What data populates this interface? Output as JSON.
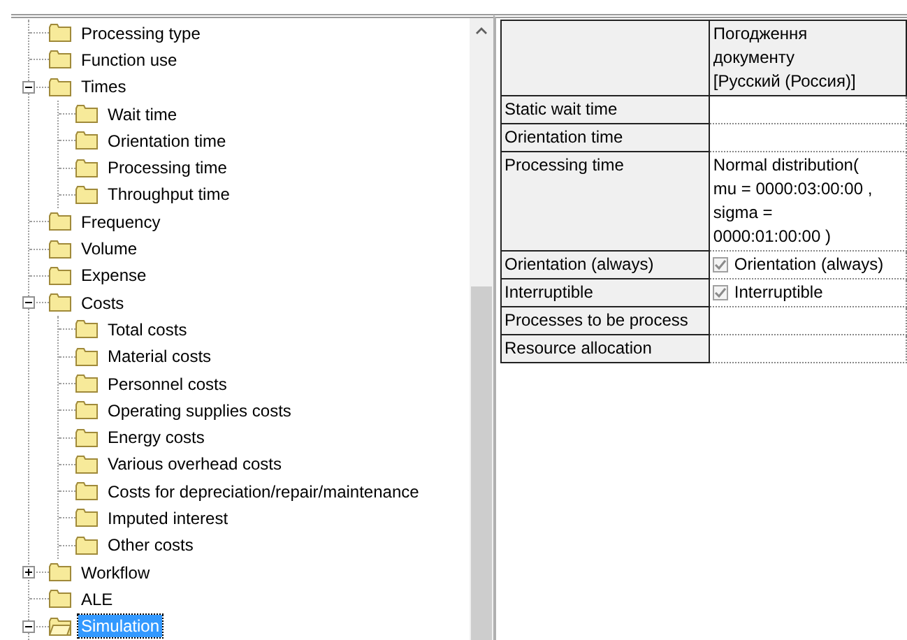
{
  "tree": {
    "items": [
      {
        "label": "Processing type",
        "selected": false
      },
      {
        "label": "Function use",
        "selected": false
      },
      {
        "label": "Times",
        "selected": false,
        "expanded": true,
        "children": [
          {
            "label": "Wait time",
            "selected": false
          },
          {
            "label": "Orientation time",
            "selected": false
          },
          {
            "label": "Processing time",
            "selected": false
          },
          {
            "label": "Throughput time",
            "selected": false
          }
        ]
      },
      {
        "label": "Frequency",
        "selected": false
      },
      {
        "label": "Volume",
        "selected": false
      },
      {
        "label": "Expense",
        "selected": false
      },
      {
        "label": "Costs",
        "selected": false,
        "expanded": true,
        "children": [
          {
            "label": "Total costs",
            "selected": false
          },
          {
            "label": "Material costs",
            "selected": false
          },
          {
            "label": "Personnel costs",
            "selected": false
          },
          {
            "label": "Operating supplies costs",
            "selected": false
          },
          {
            "label": "Energy costs",
            "selected": false
          },
          {
            "label": "Various overhead costs",
            "selected": false
          },
          {
            "label": "Costs for depreciation/repair/maintenance",
            "selected": false
          },
          {
            "label": "Imputed interest",
            "selected": false
          },
          {
            "label": "Other costs",
            "selected": false
          }
        ]
      },
      {
        "label": "Workflow",
        "selected": false,
        "expanded": false
      },
      {
        "label": "ALE",
        "selected": false
      },
      {
        "label": "Simulation",
        "selected": true,
        "expanded": true
      }
    ]
  },
  "table": {
    "header_lines": [
      "Погодження",
      "документу",
      "[Русский (Россия)]"
    ],
    "rows": [
      {
        "label": "Static wait time",
        "kind": "empty"
      },
      {
        "label": "Orientation time",
        "kind": "empty"
      },
      {
        "label": "Processing time",
        "kind": "text",
        "lines": [
          "Normal distribution(",
          "mu = 0000:03:00:00 ,",
          "sigma =",
          "0000:01:00:00 )"
        ]
      },
      {
        "label": "Orientation (always)",
        "kind": "checkbox",
        "checked": true,
        "value": "Orientation (always)"
      },
      {
        "label": "Interruptible",
        "kind": "checkbox",
        "checked": true,
        "value": "Interruptible"
      },
      {
        "label": "Processes to be process",
        "kind": "empty"
      },
      {
        "label": "Resource allocation",
        "kind": "empty"
      }
    ]
  }
}
